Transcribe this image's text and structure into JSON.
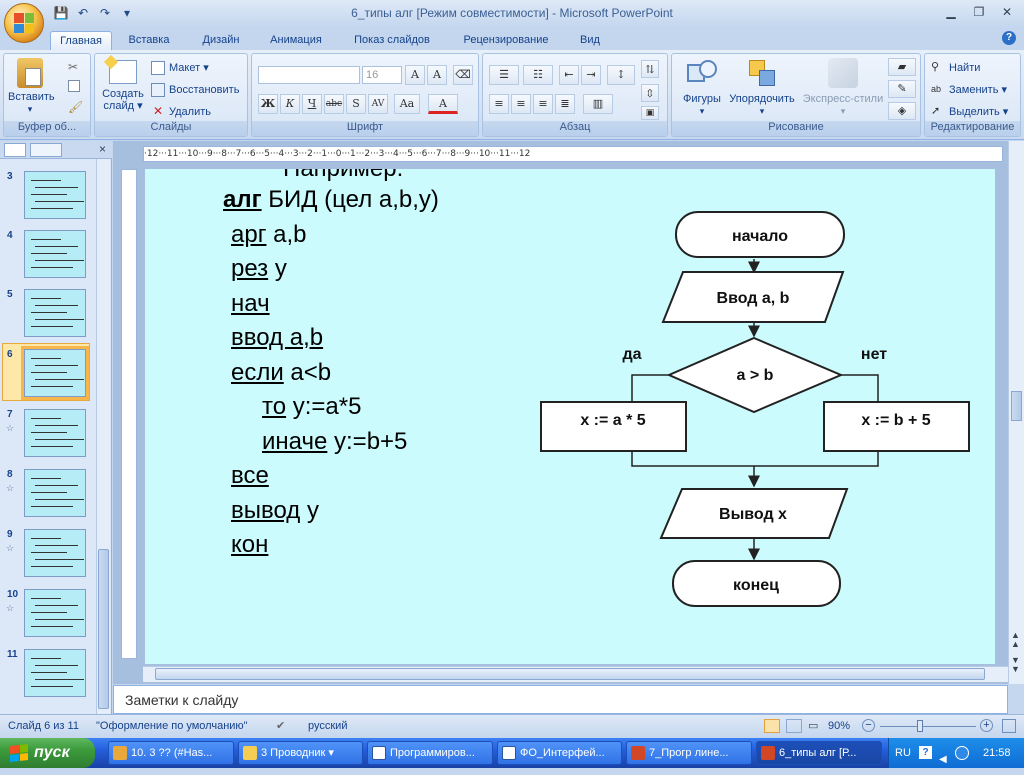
{
  "window": {
    "title": "6_типы алг [Режим совместимости] - Microsoft PowerPoint"
  },
  "tabs": [
    "Главная",
    "Вставка",
    "Дизайн",
    "Анимация",
    "Показ слайдов",
    "Рецензирование",
    "Вид"
  ],
  "ribbon": {
    "clipboard": {
      "label": "Буфер об...",
      "paste": "Вставить"
    },
    "slides": {
      "label": "Слайды",
      "new_slide_1": "Создать",
      "new_slide_2": "слайд",
      "layout": "Макет",
      "reset": "Восстановить",
      "delete": "Удалить"
    },
    "font": {
      "label": "Шрифт",
      "size": "16"
    },
    "paragraph": {
      "label": "Абзац"
    },
    "drawing": {
      "label": "Рисование",
      "shapes": "Фигуры",
      "arrange": "Упорядочить",
      "styles": "Экспресс-стили"
    },
    "editing": {
      "label": "Редактирование",
      "find": "Найти",
      "replace": "Заменить",
      "select": "Выделить"
    }
  },
  "ruler": {
    "h": "·12···11···10···9···8···7···6···5···4···3···2···1···0···1···2···3···4···5···6···7···8···9···10···11···12"
  },
  "thumbnails": [
    {
      "n": "3"
    },
    {
      "n": "4"
    },
    {
      "n": "5"
    },
    {
      "n": "6"
    },
    {
      "n": "7"
    },
    {
      "n": "8"
    },
    {
      "n": "9"
    },
    {
      "n": "10"
    },
    {
      "n": "11"
    }
  ],
  "slide": {
    "cut_heading": "Например:",
    "code": {
      "l1_kw": "алг",
      "l1_rest": " БИД (цел а,b,y)",
      "l2_kw": "арг",
      "l2_rest": " a,b",
      "l3_kw": "рез",
      "l3_rest": " y",
      "l4_kw": "нач",
      "l5_kw": "ввод a,b",
      "l6_kw": "если",
      "l6_rest": " a<b",
      "l7_kw": "то",
      "l7_rest": " y:=a*5",
      "l8_kw": "иначе",
      "l8_rest": " y:=b+5",
      "l9_kw": "все ",
      "l10_kw": "вывод",
      "l10_rest": " y",
      "l11_kw": "кон"
    },
    "flow": {
      "start": "начало",
      "input": "Ввод a, b",
      "cond": "a > b",
      "yes": "да",
      "no": "нет",
      "left": "x := a * 5",
      "right": "x := b + 5",
      "output": "Вывод x",
      "end": "конец"
    }
  },
  "notes": {
    "placeholder": "Заметки к слайду"
  },
  "status": {
    "slide": "Слайд 6 из 11",
    "theme": "\"Оформление по умолчанию\"",
    "lang": "русский",
    "zoom": "90%"
  },
  "taskbar": {
    "start": "пуск",
    "items": [
      "10. 3 ?? (#Has...",
      "3 Проводник",
      "Программиров...",
      "ФО_Интерфей...",
      "7_Прогр лине...",
      "6_типы алг [Р..."
    ],
    "lang": "RU",
    "time": "21:58"
  }
}
